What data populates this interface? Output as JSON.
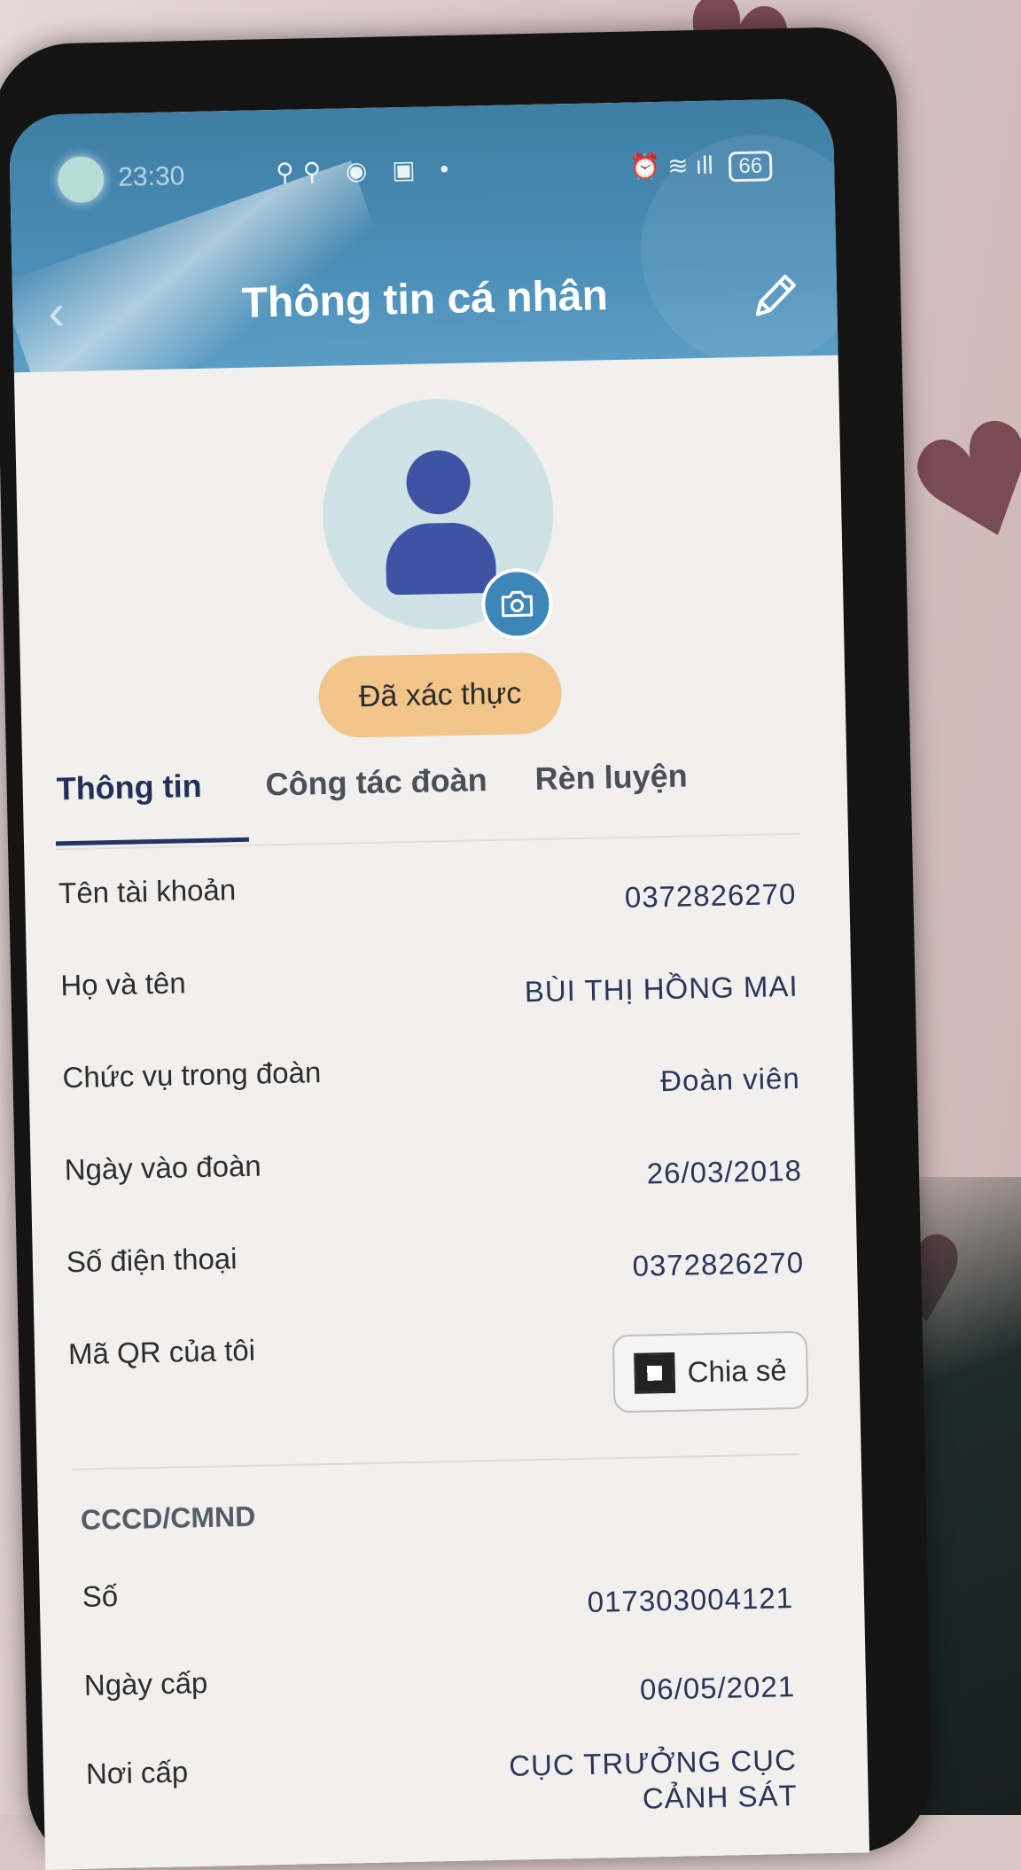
{
  "status_bar": {
    "time": "23:30",
    "left_icons": "⚲⚲ ◉ ▣ •",
    "right_icons": "⏰ ≋ ıll",
    "battery": "66"
  },
  "header": {
    "title": "Thông tin cá nhân"
  },
  "profile": {
    "verified_label": "Đã xác thực"
  },
  "tabs": [
    {
      "label": "Thông tin",
      "active": true
    },
    {
      "label": "Công tác đoàn",
      "active": false
    },
    {
      "label": "Rèn luyện",
      "active": false
    }
  ],
  "info_rows": [
    {
      "label": "Tên tài khoản",
      "value": "0372826270"
    },
    {
      "label": "Họ và tên",
      "value": "BÙI THỊ HỒNG MAI"
    },
    {
      "label": "Chức vụ trong đoàn",
      "value": "Đoàn viên"
    },
    {
      "label": "Ngày vào đoàn",
      "value": "26/03/2018"
    },
    {
      "label": "Số điện thoại",
      "value": "0372826270"
    }
  ],
  "qr_row": {
    "label": "Mã QR của tôi",
    "button_label": "Chia sẻ"
  },
  "id_section": {
    "title": "CCCD/CMND",
    "rows": [
      {
        "label": "Số",
        "value": "017303004121"
      },
      {
        "label": "Ngày cấp",
        "value": "06/05/2021"
      },
      {
        "label": "Nơi cấp",
        "value": "CỤC TRƯỞNG CỤC",
        "value_line2": "CẢNH SÁT"
      }
    ]
  },
  "colors": {
    "header": "#4a8db6",
    "avatar_icon": "#3f53a4",
    "verified_badge": "#f2c58b",
    "active_tab": "#223058"
  }
}
